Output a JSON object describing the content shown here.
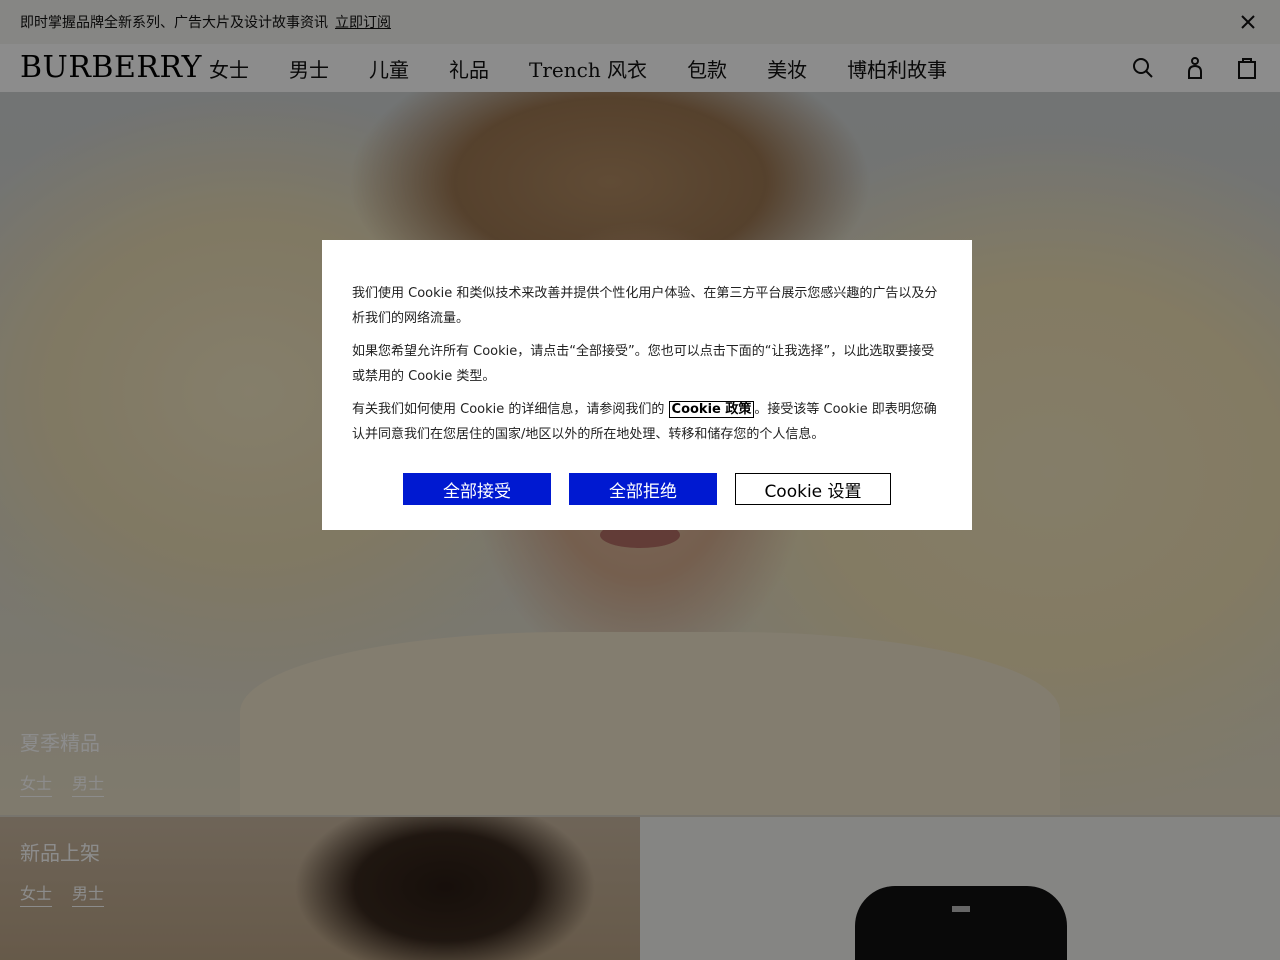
{
  "announcement": {
    "text": "即时掌握品牌全新系列、广告大片及设计故事资讯",
    "link": "立即订阅"
  },
  "header": {
    "logo": "BURBERRY",
    "nav": [
      "女士",
      "男士",
      "儿童",
      "礼品",
      "Trench 风衣",
      "包款",
      "美妆",
      "博柏利故事"
    ],
    "icons": [
      "search-icon",
      "account-icon",
      "shopping-bag-icon"
    ]
  },
  "hero": {
    "title": "夏季精品",
    "links": [
      "女士",
      "男士"
    ]
  },
  "tiles": {
    "left": {
      "title": "新品上架",
      "links": [
        "女士",
        "男士"
      ]
    }
  },
  "cookie": {
    "p1": "我们使用 Cookie 和类似技术来改善并提供个性化用户体验、在第三方平台展示您感兴趣的广告以及分析我们的网络流量。",
    "p2": "如果您希望允许所有 Cookie，请点击“全部接受”。您也可以点击下面的“让我选择”，以此选取要接受或禁用的 Cookie 类型。",
    "p3_before": "有关我们如何使用 Cookie 的详细信息，请参阅我们的",
    "policy_link": "Cookie 政策",
    "p3_after": "。接受该等 Cookie 即表明您确认并同意我们在您居住的国家/地区以外的所在地处理、转移和储存您的个人信息。",
    "accept_all": "全部接受",
    "reject_all": "全部拒绝",
    "settings": "Cookie 设置"
  },
  "colors": {
    "accent_blue": "#0019d1",
    "overlay": "rgba(0,0,0,0.45)"
  }
}
